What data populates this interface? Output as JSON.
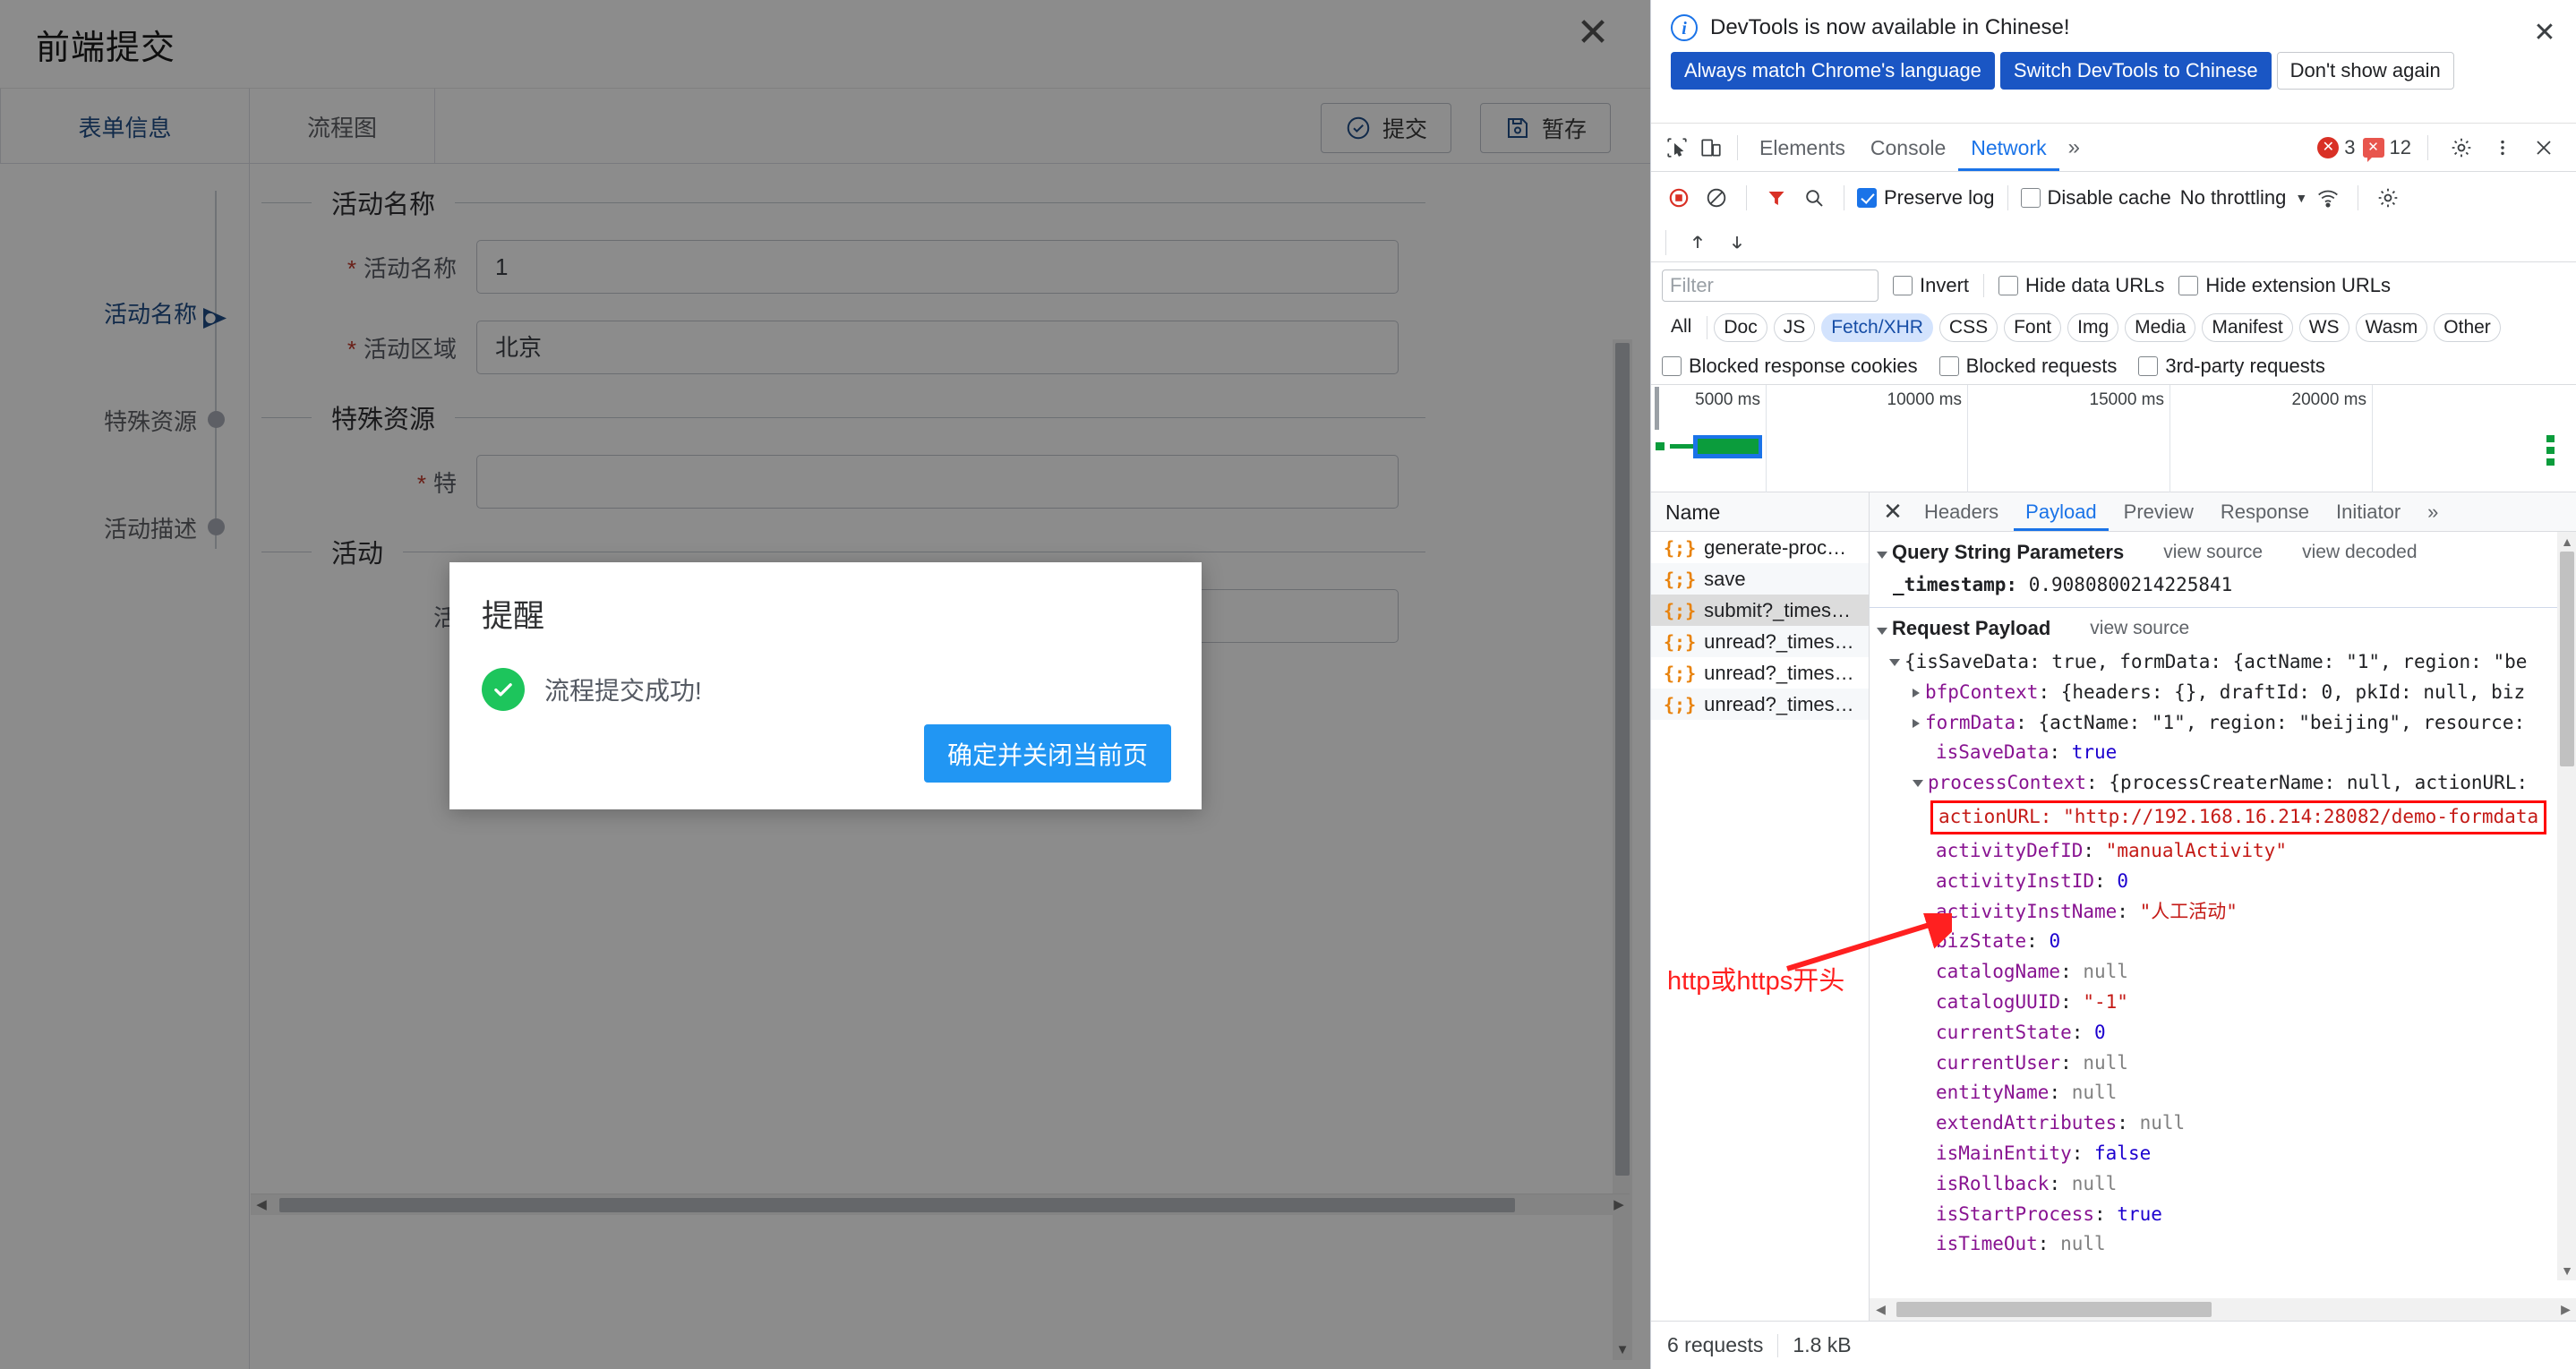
{
  "app": {
    "title": "前端提交",
    "close_label": "✕",
    "tabs": [
      {
        "label": "表单信息",
        "active": true
      },
      {
        "label": "流程图",
        "active": false
      }
    ],
    "toolbar": {
      "submit_label": "提交",
      "save_draft_label": "暂存"
    },
    "anchors": [
      {
        "label": "活动名称",
        "active": true
      },
      {
        "label": "特殊资源",
        "active": false
      },
      {
        "label": "活动描述",
        "active": false
      }
    ],
    "sections": [
      {
        "title": "活动名称"
      },
      {
        "title": "特殊资源"
      },
      {
        "title": "活动"
      }
    ],
    "fields": [
      {
        "label": "活动名称",
        "required": true,
        "value": "1"
      },
      {
        "label": "活动区域",
        "required": true,
        "value": "北京"
      },
      {
        "label": "特",
        "required": true,
        "value": ""
      },
      {
        "label": "活",
        "required": false,
        "value": ""
      }
    ]
  },
  "modal": {
    "title": "提醒",
    "message": "流程提交成功!",
    "icon": "success-check-icon",
    "confirm_label": "确定并关闭当前页",
    "accent": "#2196f3",
    "success_color": "#1dc55c"
  },
  "devtools": {
    "banner": {
      "text": "DevTools is now available in Chinese!",
      "buttons": [
        {
          "label": "Always match Chrome's language",
          "style": "primary"
        },
        {
          "label": "Switch DevTools to Chinese",
          "style": "primary"
        },
        {
          "label": "Don't show again",
          "style": "outline"
        }
      ],
      "close_label": "✕"
    },
    "panel_tabs": [
      {
        "label": "Elements",
        "active": false
      },
      {
        "label": "Console",
        "active": false
      },
      {
        "label": "Network",
        "active": true
      }
    ],
    "more_tabs_label": "»",
    "errors_count": "3",
    "warnings_count": "12",
    "network_toolbar": {
      "preserve_log_label": "Preserve log",
      "preserve_log_checked": true,
      "disable_cache_label": "Disable cache",
      "disable_cache_checked": false,
      "throttling_label": "No throttling"
    },
    "filter": {
      "placeholder": "Filter",
      "value": "",
      "invert_label": "Invert",
      "hide_data_urls_label": "Hide data URLs",
      "hide_extension_urls_label": "Hide extension URLs"
    },
    "type_chips": [
      {
        "label": "All",
        "selected": false
      },
      {
        "label": "Doc",
        "selected": false
      },
      {
        "label": "JS",
        "selected": false
      },
      {
        "label": "Fetch/XHR",
        "selected": true
      },
      {
        "label": "CSS",
        "selected": false
      },
      {
        "label": "Font",
        "selected": false
      },
      {
        "label": "Img",
        "selected": false
      },
      {
        "label": "Media",
        "selected": false
      },
      {
        "label": "Manifest",
        "selected": false
      },
      {
        "label": "WS",
        "selected": false
      },
      {
        "label": "Wasm",
        "selected": false
      },
      {
        "label": "Other",
        "selected": false
      }
    ],
    "blocked_row": {
      "blocked_response_cookies_label": "Blocked response cookies",
      "blocked_requests_label": "Blocked requests",
      "third_party_requests_label": "3rd-party requests"
    },
    "overview_ticks": [
      "5000 ms",
      "10000 ms",
      "15000 ms",
      "20000 ms"
    ],
    "request_list": {
      "header": "Name",
      "items": [
        {
          "name": "generate-proc…",
          "selected": false
        },
        {
          "name": "save",
          "selected": false
        },
        {
          "name": "submit?_times…",
          "selected": true
        },
        {
          "name": "unread?_times…",
          "selected": false
        },
        {
          "name": "unread?_times…",
          "selected": false
        },
        {
          "name": "unread?_times…",
          "selected": false
        }
      ]
    },
    "detail_tabs": [
      {
        "label": "Headers",
        "active": false
      },
      {
        "label": "Payload",
        "active": true
      },
      {
        "label": "Preview",
        "active": false
      },
      {
        "label": "Response",
        "active": false
      },
      {
        "label": "Initiator",
        "active": false
      }
    ],
    "detail_more_label": "»",
    "detail_close_label": "✕",
    "payload": {
      "query_section_title": "Query String Parameters",
      "query_view_source": "view source",
      "query_view_decoded": "view decoded",
      "query_params": [
        {
          "key": "_timestamp:",
          "value": "0.9080800214225841"
        }
      ],
      "request_section_title": "Request Payload",
      "request_view_source": "view source",
      "root_line": "{isSaveData: true, formData: {actName: \"1\", region: \"be",
      "lines": [
        {
          "indent": 2,
          "arrow": "right",
          "key": "bfpContext",
          "text": "{headers: {}, draftId: 0, pkId: null, biz"
        },
        {
          "indent": 2,
          "arrow": "right",
          "key": "formData",
          "text": "{actName: \"1\", region: \"beijing\", resource:"
        },
        {
          "indent": 2,
          "arrow": "none",
          "key": "isSaveData",
          "value": "true",
          "vtype": "bool"
        },
        {
          "indent": 2,
          "arrow": "down",
          "key": "processContext",
          "text": "{processCreaterName: null, actionURL:"
        },
        {
          "indent": 3,
          "arrow": "none",
          "key": "actionURL",
          "value": "\"http://192.168.16.214:28082/demo-formdata",
          "vtype": "str",
          "highlight": true
        },
        {
          "indent": 3,
          "arrow": "none",
          "key": "activityDefID",
          "value": "\"manualActivity\"",
          "vtype": "str"
        },
        {
          "indent": 3,
          "arrow": "none",
          "key": "activityInstID",
          "value": "0",
          "vtype": "num"
        },
        {
          "indent": 3,
          "arrow": "none",
          "key": "activityInstName",
          "value": "\"人工活动\"",
          "vtype": "str"
        },
        {
          "indent": 3,
          "arrow": "none",
          "key": "bizState",
          "value": "0",
          "vtype": "num"
        },
        {
          "indent": 3,
          "arrow": "none",
          "key": "catalogName",
          "value": "null",
          "vtype": "null"
        },
        {
          "indent": 3,
          "arrow": "none",
          "key": "catalogUUID",
          "value": "\"-1\"",
          "vtype": "str"
        },
        {
          "indent": 3,
          "arrow": "none",
          "key": "currentState",
          "value": "0",
          "vtype": "num"
        },
        {
          "indent": 3,
          "arrow": "none",
          "key": "currentUser",
          "value": "null",
          "vtype": "null"
        },
        {
          "indent": 3,
          "arrow": "none",
          "key": "entityName",
          "value": "null",
          "vtype": "null"
        },
        {
          "indent": 3,
          "arrow": "none",
          "key": "extendAttributes",
          "value": "null",
          "vtype": "null"
        },
        {
          "indent": 3,
          "arrow": "none",
          "key": "isMainEntity",
          "value": "false",
          "vtype": "bool"
        },
        {
          "indent": 3,
          "arrow": "none",
          "key": "isRollback",
          "value": "null",
          "vtype": "null"
        },
        {
          "indent": 3,
          "arrow": "none",
          "key": "isStartProcess",
          "value": "true",
          "vtype": "bool"
        },
        {
          "indent": 3,
          "arrow": "none",
          "key": "isTimeOut",
          "value": "null",
          "vtype": "null"
        }
      ]
    },
    "status_bar": {
      "requests": "6 requests",
      "size": "1.8 kB"
    }
  },
  "annotation": {
    "text": "http或https开头",
    "color": "#ff2020"
  }
}
